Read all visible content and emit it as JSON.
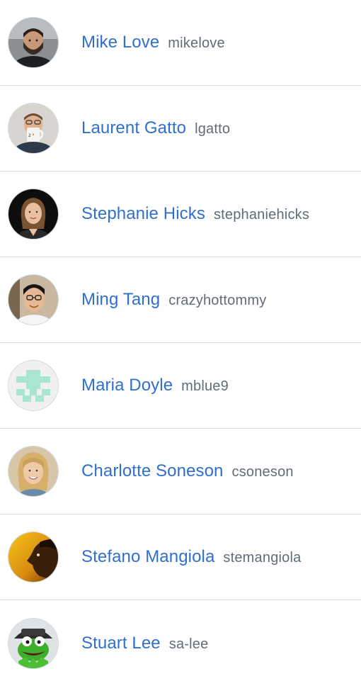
{
  "contributors": [
    {
      "name": "Mike Love",
      "login": "mikelove",
      "avatar": "photo-man-beard-icon"
    },
    {
      "name": "Laurent Gatto",
      "login": "lgatto",
      "avatar": "photo-man-mug-icon"
    },
    {
      "name": "Stephanie Hicks",
      "login": "stephaniehicks",
      "avatar": "photo-woman-dark-bg-icon"
    },
    {
      "name": "Ming Tang",
      "login": "crazyhottommy",
      "avatar": "photo-man-glasses-icon"
    },
    {
      "name": "Maria Doyle",
      "login": "mblue9",
      "avatar": "identicon-icon"
    },
    {
      "name": "Charlotte Soneson",
      "login": "csoneson",
      "avatar": "photo-woman-blonde-icon"
    },
    {
      "name": "Stefano Mangiola",
      "login": "stemangiola",
      "avatar": "photo-man-profile-icon"
    },
    {
      "name": "Stuart Lee",
      "login": "sa-lee",
      "avatar": "kermit-frog-icon"
    }
  ],
  "colors": {
    "name_link": "#2f6fd0",
    "login_text": "#636c76",
    "divider": "#d8dee4",
    "identicon": "#a8e6cf"
  }
}
